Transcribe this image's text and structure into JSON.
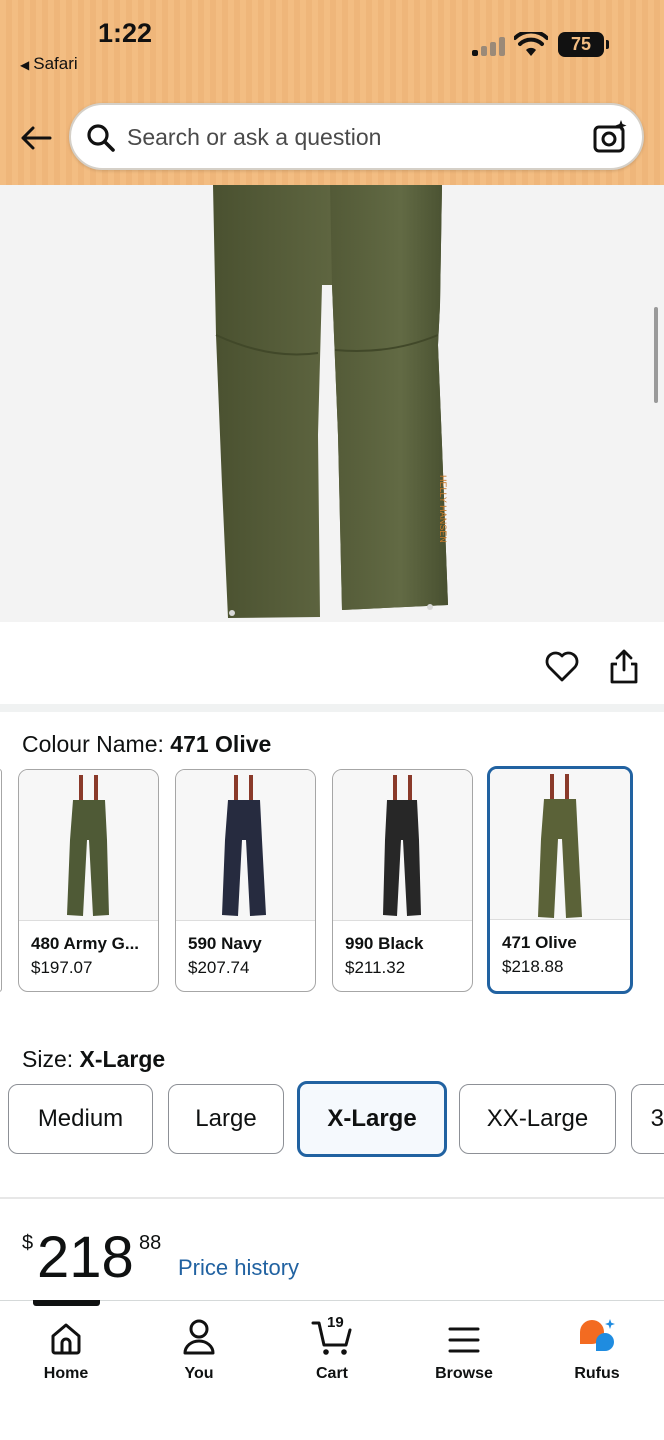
{
  "status_bar": {
    "time": "1:22",
    "back_app": "Safari",
    "battery": "75"
  },
  "search": {
    "placeholder": "Search or ask a question"
  },
  "colour": {
    "label": "Colour Name: ",
    "selected": "471 Olive",
    "options": [
      {
        "name": "480 Army G...",
        "price": "$197.07",
        "color": "#4f5a36"
      },
      {
        "name": "590 Navy",
        "price": "$207.74",
        "color": "#262b3f"
      },
      {
        "name": "990 Black",
        "price": "$211.32",
        "color": "#272727"
      },
      {
        "name": "471 Olive",
        "price": "$218.88",
        "color": "#5b6238"
      }
    ]
  },
  "size": {
    "label": "Size: ",
    "selected": "X-Large",
    "options": [
      "Medium",
      "Large",
      "X-Large",
      "XX-Large",
      "3"
    ]
  },
  "price": {
    "symbol": "$",
    "whole": "218",
    "fraction": "88",
    "history_link": "Price history"
  },
  "nav": {
    "items": [
      {
        "label": "Home"
      },
      {
        "label": "You"
      },
      {
        "label": "Cart",
        "count": "19"
      },
      {
        "label": "Browse"
      },
      {
        "label": "Rufus"
      }
    ]
  },
  "colors": {
    "header_bg": "#f3bd82",
    "accent_blue": "#2162a1",
    "product_olive": "#5b6238"
  }
}
